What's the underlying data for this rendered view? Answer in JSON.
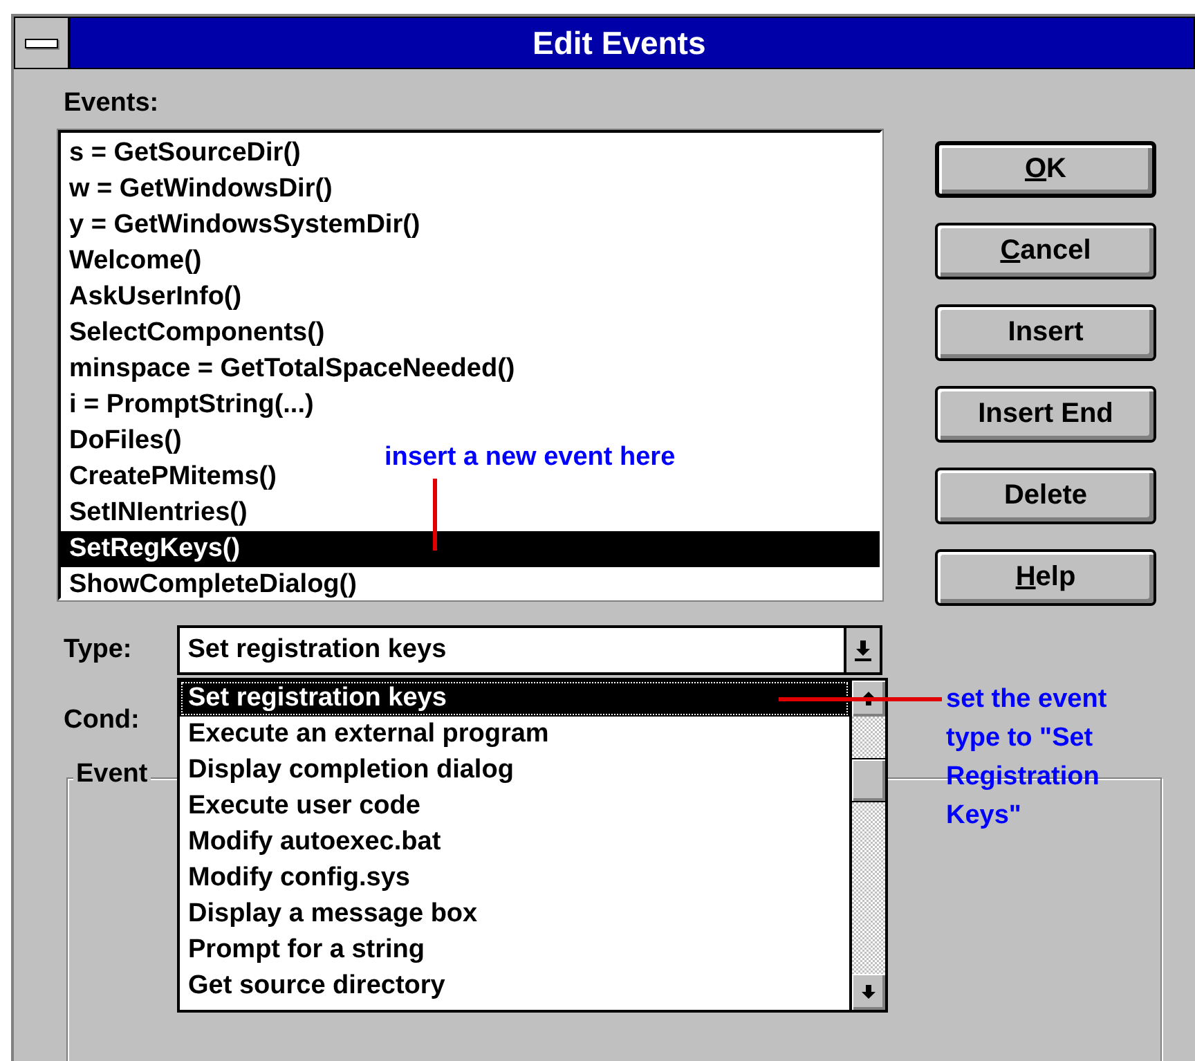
{
  "window": {
    "title": "Edit Events"
  },
  "events_label": "Events:",
  "events": [
    {
      "text": "s = GetSourceDir()",
      "selected": false
    },
    {
      "text": "w = GetWindowsDir()",
      "selected": false
    },
    {
      "text": "y = GetWindowsSystemDir()",
      "selected": false
    },
    {
      "text": "Welcome()",
      "selected": false
    },
    {
      "text": "AskUserInfo()",
      "selected": false
    },
    {
      "text": "SelectComponents()",
      "selected": false
    },
    {
      "text": "minspace = GetTotalSpaceNeeded()",
      "selected": false
    },
    {
      "text": "i = PromptString(...)",
      "selected": false
    },
    {
      "text": "DoFiles()",
      "selected": false
    },
    {
      "text": "CreatePMitems()",
      "selected": false
    },
    {
      "text": "SetINIentries()",
      "selected": false
    },
    {
      "text": "SetRegKeys()",
      "selected": true
    },
    {
      "text": "ShowCompleteDialog()",
      "selected": false
    }
  ],
  "buttons": [
    {
      "label": "OK",
      "default": true,
      "mnemonic_underlined": true
    },
    {
      "label": "Cancel",
      "default": false,
      "mnemonic_underlined": true
    },
    {
      "label": "Insert",
      "default": false,
      "mnemonic_underlined": false
    },
    {
      "label": "Insert End",
      "default": false,
      "mnemonic_underlined": false
    },
    {
      "label": "Delete",
      "default": false,
      "mnemonic_underlined": false
    },
    {
      "label": "Help",
      "default": false,
      "mnemonic_underlined": true
    }
  ],
  "type_label": "Type:",
  "type_value": "Set registration keys",
  "cond_label": "Cond:",
  "type_options": [
    {
      "text": "Set registration keys",
      "selected": true
    },
    {
      "text": "Execute an external program",
      "selected": false
    },
    {
      "text": "Display completion dialog",
      "selected": false
    },
    {
      "text": "Execute user code",
      "selected": false
    },
    {
      "text": "Modify autoexec.bat",
      "selected": false
    },
    {
      "text": "Modify config.sys",
      "selected": false
    },
    {
      "text": "Display a message box",
      "selected": false
    },
    {
      "text": "Prompt for a string",
      "selected": false
    },
    {
      "text": "Get source directory",
      "selected": false
    }
  ],
  "event_group_label": "Event",
  "annotations": [
    {
      "text": "insert a new event here"
    },
    {
      "text": "set the event type to \"Set Registration Keys\""
    }
  ]
}
